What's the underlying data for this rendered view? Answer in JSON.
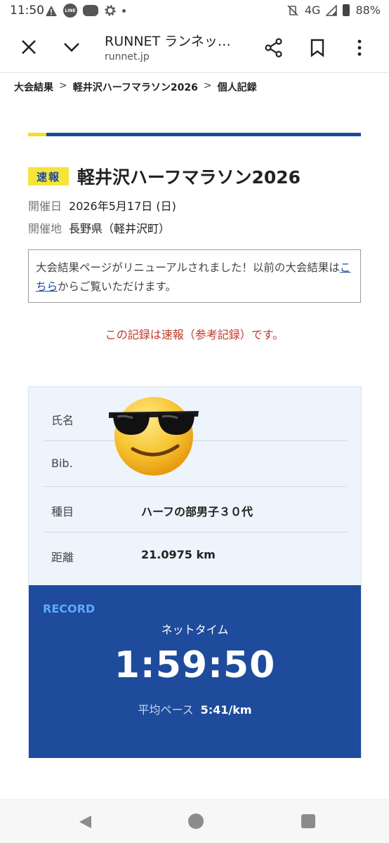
{
  "status_bar": {
    "time": "11:50",
    "network": "4G",
    "battery": "88%",
    "line_badge": "LINE"
  },
  "browser": {
    "title": "RUNNET ランネッ…",
    "url": "runnet.jp"
  },
  "breadcrumb": {
    "items": [
      "大会結果",
      "軽井沢ハーフマラソン2026",
      "個人記録"
    ],
    "separator": ">"
  },
  "race": {
    "badge": "速報",
    "title": "軽井沢ハーフマラソン2026",
    "date_label": "開催日",
    "date_value": "2026年5月17日 (日)",
    "place_label": "開催地",
    "place_value": "長野県（軽井沢町）"
  },
  "notice": {
    "text_before": "大会結果ページがリニューアルされました！以前の大会結果は",
    "link_text": "こちら",
    "text_after": "からご覧いただけます。"
  },
  "warning": "この記録は速報（参考記録）です。",
  "result": {
    "rows": [
      {
        "label": "氏名",
        "value": ""
      },
      {
        "label": "Bib.",
        "value": ""
      },
      {
        "label": "種目",
        "value": "ハーフの部男子３０代"
      },
      {
        "label": "距離",
        "value": "21.0975 km"
      }
    ],
    "record_label": "RECORD",
    "net_time_label": "ネットタイム",
    "net_time": "1:59:50",
    "pace_label": "平均ペース",
    "pace_value": "5:41/km"
  },
  "colors": {
    "brand_blue": "#1e4b9b",
    "accent_yellow": "#f6e43a",
    "warning_red": "#c0392b",
    "record_label_blue": "#5fa8ff"
  }
}
